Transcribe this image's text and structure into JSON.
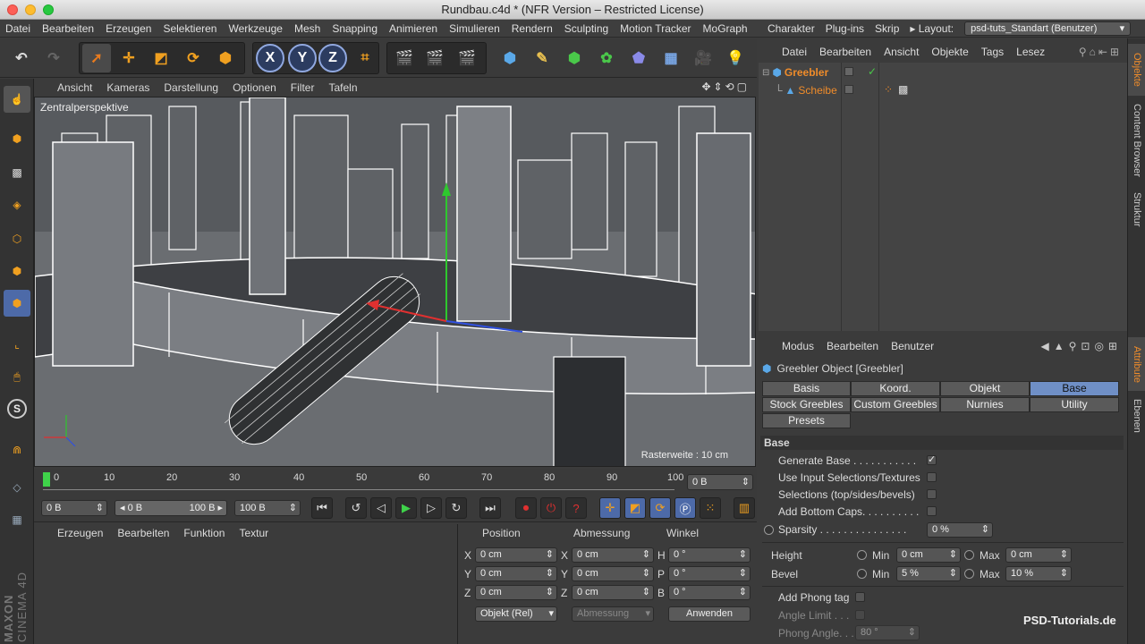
{
  "window": {
    "title": "Rundbau.c4d * (NFR Version – Restricted License)"
  },
  "menubar": {
    "items": [
      "Datei",
      "Bearbeiten",
      "Erzeugen",
      "Selektieren",
      "Werkzeuge",
      "Mesh",
      "Snapping",
      "Animieren",
      "Simulieren",
      "Rendern",
      "Sculpting",
      "Motion Tracker",
      "MoGraph"
    ],
    "right_items": [
      "Charakter",
      "Plug-ins",
      "Skrip"
    ],
    "layout_label": "Layout:",
    "layout_value": "psd-tuts_Standart (Benutzer)"
  },
  "toolbar": {
    "axis_x": "X",
    "axis_y": "Y",
    "axis_z": "Z"
  },
  "viewport": {
    "menu": [
      "Ansicht",
      "Kameras",
      "Darstellung",
      "Optionen",
      "Filter",
      "Tafeln"
    ],
    "label": "Zentralperspektive",
    "grid_info": "Rasterweite : 10 cm"
  },
  "timeline": {
    "ticks": [
      "0",
      "10",
      "20",
      "30",
      "40",
      "50",
      "60",
      "70",
      "80",
      "90",
      "100"
    ],
    "current_frame": "0 B"
  },
  "transport": {
    "start": "0 B",
    "range_min": "0 B",
    "range_max": "100 B",
    "end": "100 B"
  },
  "material_panel": {
    "menu": [
      "Erzeugen",
      "Bearbeiten",
      "Funktion",
      "Textur"
    ]
  },
  "coord_panel": {
    "headers": [
      "Position",
      "Abmessung",
      "Winkel"
    ],
    "rows": [
      {
        "pos_label": "X",
        "pos": "0 cm",
        "size_label": "X",
        "size": "0 cm",
        "rot_label": "H",
        "rot": "0 °"
      },
      {
        "pos_label": "Y",
        "pos": "0 cm",
        "size_label": "Y",
        "size": "0 cm",
        "rot_label": "P",
        "rot": "0 °"
      },
      {
        "pos_label": "Z",
        "pos": "0 cm",
        "size_label": "Z",
        "size": "0 cm",
        "rot_label": "B",
        "rot": "0 °"
      }
    ],
    "mode": "Objekt (Rel)",
    "size_mode": "Abmessung",
    "apply": "Anwenden"
  },
  "object_manager": {
    "menu": [
      "Datei",
      "Bearbeiten",
      "Ansicht",
      "Objekte",
      "Tags",
      "Lesez"
    ],
    "objects": [
      {
        "name": "Greebler"
      },
      {
        "name": "Scheibe"
      }
    ]
  },
  "attribute_manager": {
    "menu": [
      "Modus",
      "Bearbeiten",
      "Benutzer"
    ],
    "title": "Greebler Object [Greebler]",
    "tabs": [
      "Basis",
      "Koord.",
      "Objekt",
      "Base",
      "Stock Greebles",
      "Custom Greebles",
      "Nurnies",
      "Utility",
      "Presets"
    ],
    "active_tab": "Base",
    "section": "Base",
    "params": {
      "generate_base": "Generate Base . . . . . . . . . . .",
      "use_input": "Use Input Selections/Textures",
      "selections": "Selections (top/sides/bevels)",
      "bottom_caps": "Add Bottom Caps. . . . . . . . . .",
      "sparsity": "Sparsity . . . . . . . . . . . . . . .",
      "sparsity_value": "0 %",
      "height": "Height",
      "bevel": "Bevel",
      "min": "Min",
      "max": "Max",
      "height_min": "0 cm",
      "height_max": "0 cm",
      "bevel_min": "5 %",
      "bevel_max": "10 %",
      "phong_tag": "Add Phong tag",
      "angle_limit": "Angle Limit . . .",
      "phong_angle": "Phong Angle. . .",
      "phong_angle_value": "80 °"
    }
  },
  "side_tabs": [
    "Objekte",
    "Content Browser",
    "Struktur",
    "Attribute",
    "Ebenen"
  ],
  "branding": {
    "maxon": "MAXON",
    "cinema": "CINEMA 4D",
    "watermark": "PSD-Tutorials.de"
  }
}
